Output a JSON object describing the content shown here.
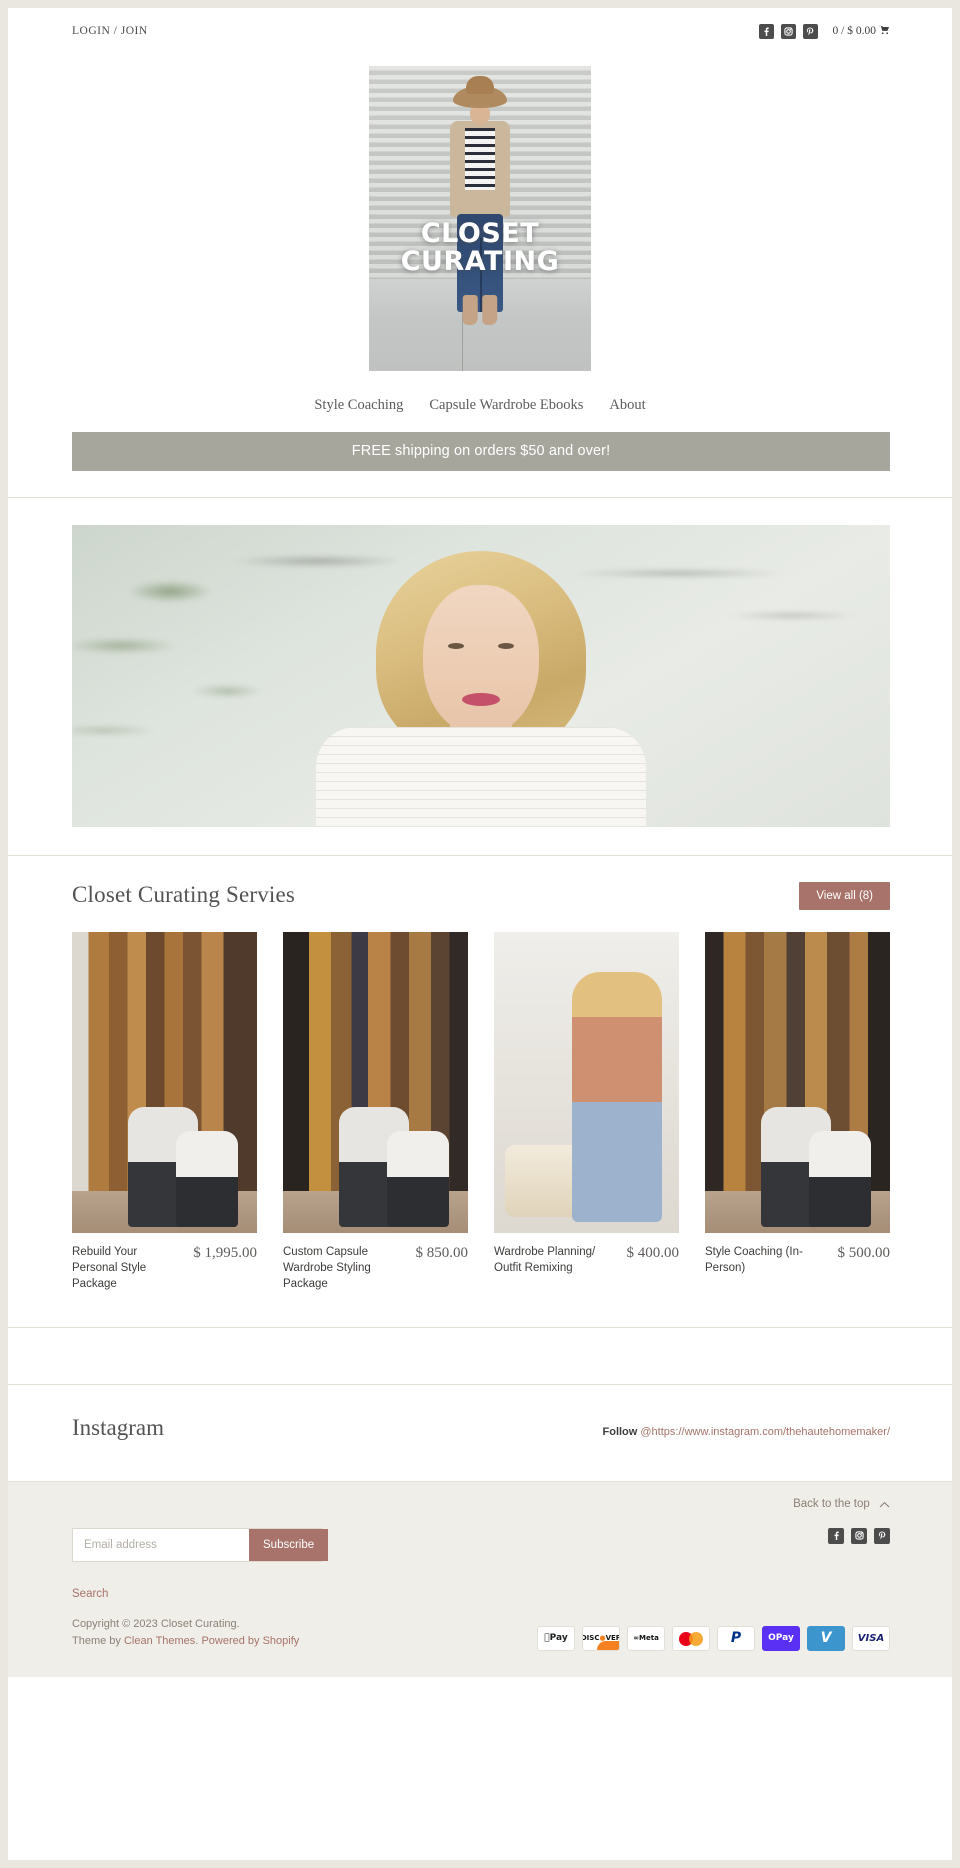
{
  "topbar": {
    "login_label": "LOGIN / JOIN",
    "social": [
      {
        "name": "facebook-icon",
        "glyph": "f"
      },
      {
        "name": "instagram-icon",
        "glyph": "▣"
      },
      {
        "name": "pinterest-icon",
        "glyph": "p"
      }
    ],
    "cart_label": "0 / $ 0.00",
    "cart_icon": "cart-icon"
  },
  "logo": {
    "line1": "CLOSET",
    "line2": "CURATING",
    "alt": "Closet Curating logo"
  },
  "nav": {
    "items": [
      {
        "label": "Style Coaching"
      },
      {
        "label": "Capsule Wardrobe Ebooks"
      },
      {
        "label": "About"
      }
    ]
  },
  "promo": {
    "text": "FREE shipping on orders $50 and over!",
    "bg": "#a6a69d"
  },
  "hero": {
    "alt": "Portrait of stylist smiling outdoors in white lace top"
  },
  "products_section": {
    "title": "Closet Curating Servies",
    "view_all_label": "View all (8)",
    "view_all_color": "#a7736a",
    "items": [
      {
        "title": "Rebuild Your Personal Style Package",
        "price": "$ 1,995.00",
        "image_alt": "Stylist working in a walk-in closet with client"
      },
      {
        "title": "Custom Capsule Wardrobe Styling Package",
        "price": "$ 850.00",
        "image_alt": "Closet full of clothing with stylist kneeling"
      },
      {
        "title": "Wardrobe Planning/ Outfit Remixing",
        "price": "$ 400.00",
        "image_alt": "Stylist in peach blouse folding denim"
      },
      {
        "title": "Style Coaching (In-Person)",
        "price": "$ 500.00",
        "image_alt": "Stylist organizing clothes in a closet"
      }
    ]
  },
  "instagram": {
    "title": "Instagram",
    "follow_label": "Follow",
    "handle": "@https://www.instagram.com/thehautehomemaker/"
  },
  "footer": {
    "back_to_top": "Back to the top",
    "signup": {
      "placeholder": "Email address",
      "value": "",
      "button_label": "Subscribe",
      "button_color": "#a7736a"
    },
    "social": [
      {
        "name": "facebook-icon",
        "glyph": "f"
      },
      {
        "name": "instagram-icon",
        "glyph": "▣"
      },
      {
        "name": "pinterest-icon",
        "glyph": "p"
      }
    ],
    "links": [
      {
        "label": "Search"
      }
    ],
    "copyright_line1": "Copyright © 2023 Closet Curating.",
    "theme_by_prefix": "Theme by ",
    "theme_name": "Clean Themes",
    "powered_sep": ". ",
    "powered_by": "Powered by Shopify",
    "payment_methods": [
      {
        "name": "apple-pay-icon",
        "label": "█ Pay"
      },
      {
        "name": "discover-icon",
        "label": "DISCOVER"
      },
      {
        "name": "meta-pay-icon",
        "label": "∞ Meta"
      },
      {
        "name": "mastercard-icon",
        "label": ""
      },
      {
        "name": "paypal-icon",
        "label": "P"
      },
      {
        "name": "shop-pay-icon",
        "label": "OPay"
      },
      {
        "name": "venmo-icon",
        "label": "V"
      },
      {
        "name": "visa-icon",
        "label": "VISA"
      }
    ]
  }
}
